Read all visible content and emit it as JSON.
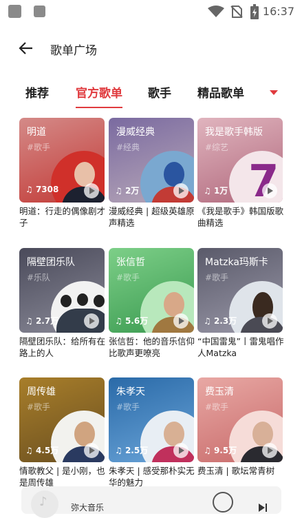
{
  "status_bar": {
    "time": "16:37"
  },
  "header": {
    "title": "歌单广场"
  },
  "tabs": [
    {
      "label": "推荐",
      "active": false
    },
    {
      "label": "官方歌单",
      "active": true
    },
    {
      "label": "歌手",
      "active": false
    },
    {
      "label": "精品歌单",
      "active": false
    }
  ],
  "playlists": [
    {
      "name": "明道",
      "tag": "#歌手",
      "plays": "7308",
      "desc": "明道：行走的偶像剧才子"
    },
    {
      "name": "漫威经典",
      "tag": "#经典",
      "plays": "2万",
      "desc": "漫威经典 | 超级英雄原声精选"
    },
    {
      "name": "我是歌手韩版",
      "tag": "#综艺",
      "plays": "1万",
      "desc": "《我是歌手》韩国版歌曲精选"
    },
    {
      "name": "隔壁团乐队",
      "tag": "#乐队",
      "plays": "2.7万",
      "desc": "隔壁团乐队：给所有在路上的人"
    },
    {
      "name": "张信哲",
      "tag": "#歌手",
      "plays": "5.6万",
      "desc": "张信哲：他的音乐信仰比歌声更嘹亮"
    },
    {
      "name": "Matzka玛斯卡",
      "tag": "#歌手",
      "plays": "2.3万",
      "desc": "“中国雷鬼”丨雷鬼唱作人Matzka"
    },
    {
      "name": "周传雄",
      "tag": "#歌手",
      "plays": "4.5万",
      "desc": "情歌教父 | 是小刚，也是周传雄"
    },
    {
      "name": "朱孝天",
      "tag": "#歌手",
      "plays": "2.5万",
      "desc": "朱孝天 | 感受那朴实无华的魅力"
    },
    {
      "name": "费玉清",
      "tag": "#歌手",
      "plays": "9.5万",
      "desc": "费玉清 | 歌坛常青树"
    }
  ],
  "player": {
    "title": "弥大音乐"
  },
  "colors": {
    "accent": "#e03a3e"
  }
}
